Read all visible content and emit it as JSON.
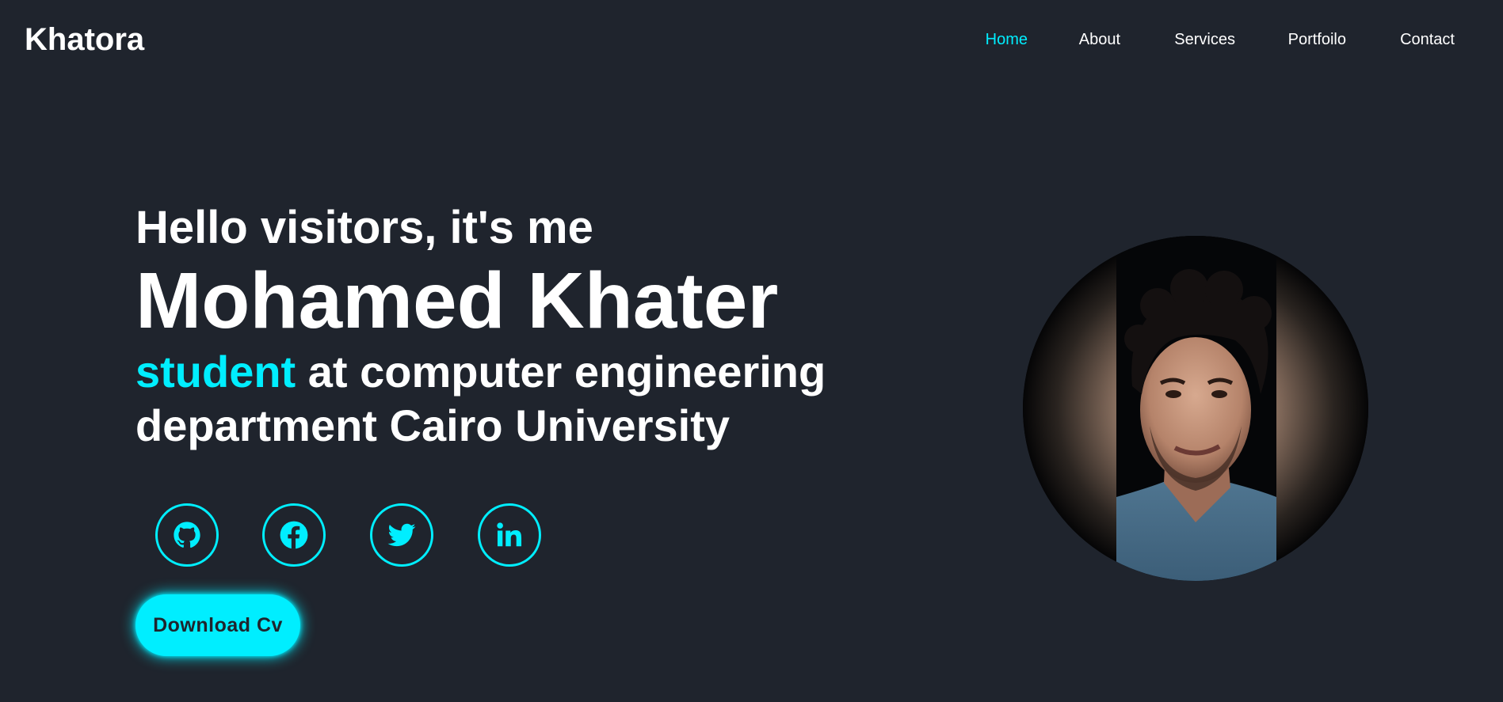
{
  "header": {
    "logo": "Khatora",
    "nav": [
      {
        "label": "Home",
        "active": true
      },
      {
        "label": "About",
        "active": false
      },
      {
        "label": "Services",
        "active": false
      },
      {
        "label": "Portfoilo",
        "active": false
      },
      {
        "label": "Contact",
        "active": false
      }
    ]
  },
  "hero": {
    "greeting": "Hello visitors, it's me",
    "name": "Mohamed Khater",
    "role_accent": "student",
    "role_rest": " at computer engineering department Cairo University"
  },
  "socials": [
    {
      "icon": "github-icon"
    },
    {
      "icon": "facebook-icon"
    },
    {
      "icon": "twitter-icon"
    },
    {
      "icon": "linkedin-icon"
    }
  ],
  "cta": {
    "label": "Download Cv"
  },
  "colors": {
    "background": "#1f242d",
    "accent": "#00eeff",
    "text": "#ffffff"
  },
  "profile_image": {
    "icon": "profile-photo"
  }
}
